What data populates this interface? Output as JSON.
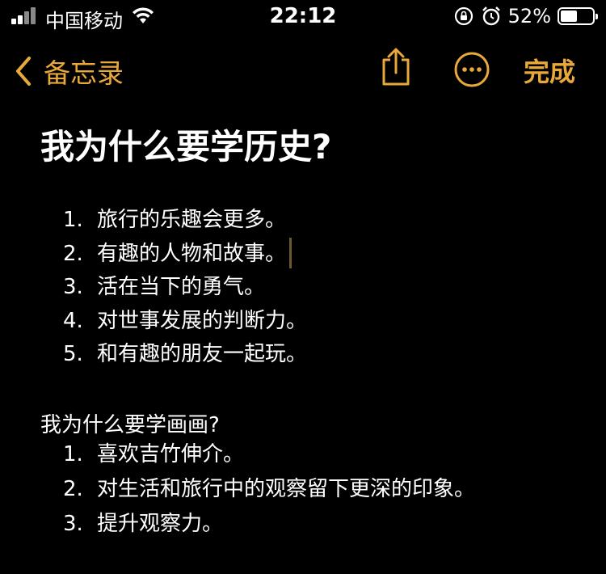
{
  "status_bar": {
    "carrier": "中国移动",
    "time": "22:12",
    "battery_percent": "52%",
    "battery_level": 0.52,
    "icons": [
      "signal-icon",
      "wifi-icon",
      "rotation-lock-icon",
      "alarm-icon",
      "battery-icon"
    ]
  },
  "nav": {
    "back_label": "备忘录",
    "done_label": "完成",
    "accent_color": "#e8a93a"
  },
  "note": {
    "title": "我为什么要学历史?",
    "list1": [
      {
        "num": "1.",
        "text": "旅行的乐趣会更多。"
      },
      {
        "num": "2.",
        "text": "有趣的人物和故事。"
      },
      {
        "num": "3.",
        "text": "活在当下的勇气。"
      },
      {
        "num": "4.",
        "text": "对世事发展的判断力。"
      },
      {
        "num": "5.",
        "text": "和有趣的朋友一起玩。"
      }
    ],
    "subtitle": "我为什么要学画画?",
    "list2": [
      {
        "num": "1.",
        "text": "喜欢吉竹伸介。"
      },
      {
        "num": "2.",
        "text": "对生活和旅行中的观察留下更深的印象。"
      },
      {
        "num": "3.",
        "text": "提升观察力。"
      }
    ]
  }
}
